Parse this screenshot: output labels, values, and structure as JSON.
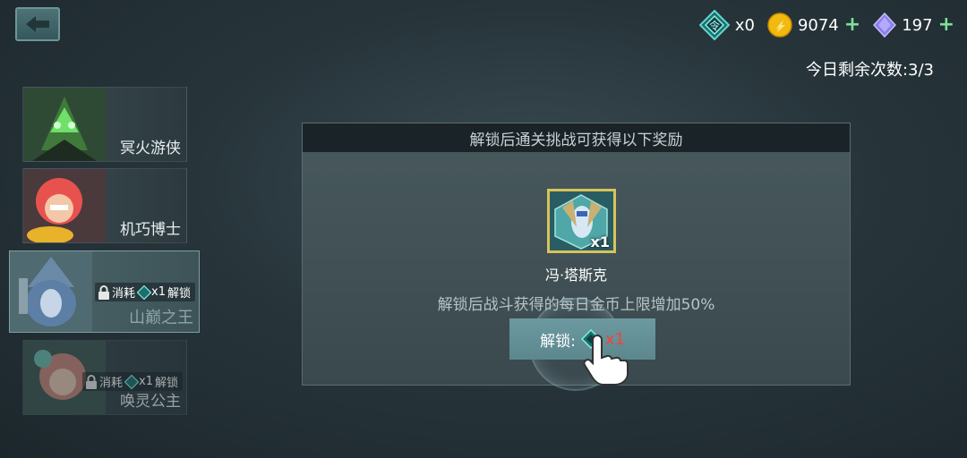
{
  "topbar": {
    "token_count": "x0",
    "gold": "9074",
    "gems": "197",
    "plus": "+"
  },
  "remaining": "今日剩余次数:3/3",
  "heroes": [
    {
      "name": "冥火游侠"
    },
    {
      "name": "机巧博士"
    },
    {
      "name": "山巅之王",
      "lock_cost_label": "消耗",
      "lock_qty": "x1",
      "lock_action": "解锁"
    },
    {
      "name": "唤灵公主",
      "lock_cost_label": "消耗",
      "lock_qty": "x1",
      "lock_action": "解锁"
    }
  ],
  "panel": {
    "title": "解锁后通关挑战可获得以下奖励",
    "reward_name": "冯·塔斯克",
    "reward_count": "x1",
    "description": "解锁后战斗获得的每日金币上限增加50%",
    "unlock_label": "解锁:",
    "unlock_qty": "x1"
  },
  "colors": {
    "accent_teal": "#5b878d",
    "gold_border": "#d8c35a",
    "cost_red": "#ff3b3b",
    "plus_green": "#7fe09a"
  },
  "icons": [
    "back-arrow-icon",
    "token-icon",
    "gold-coin-icon",
    "gem-icon",
    "lock-icon",
    "pointer-hand-icon"
  ]
}
